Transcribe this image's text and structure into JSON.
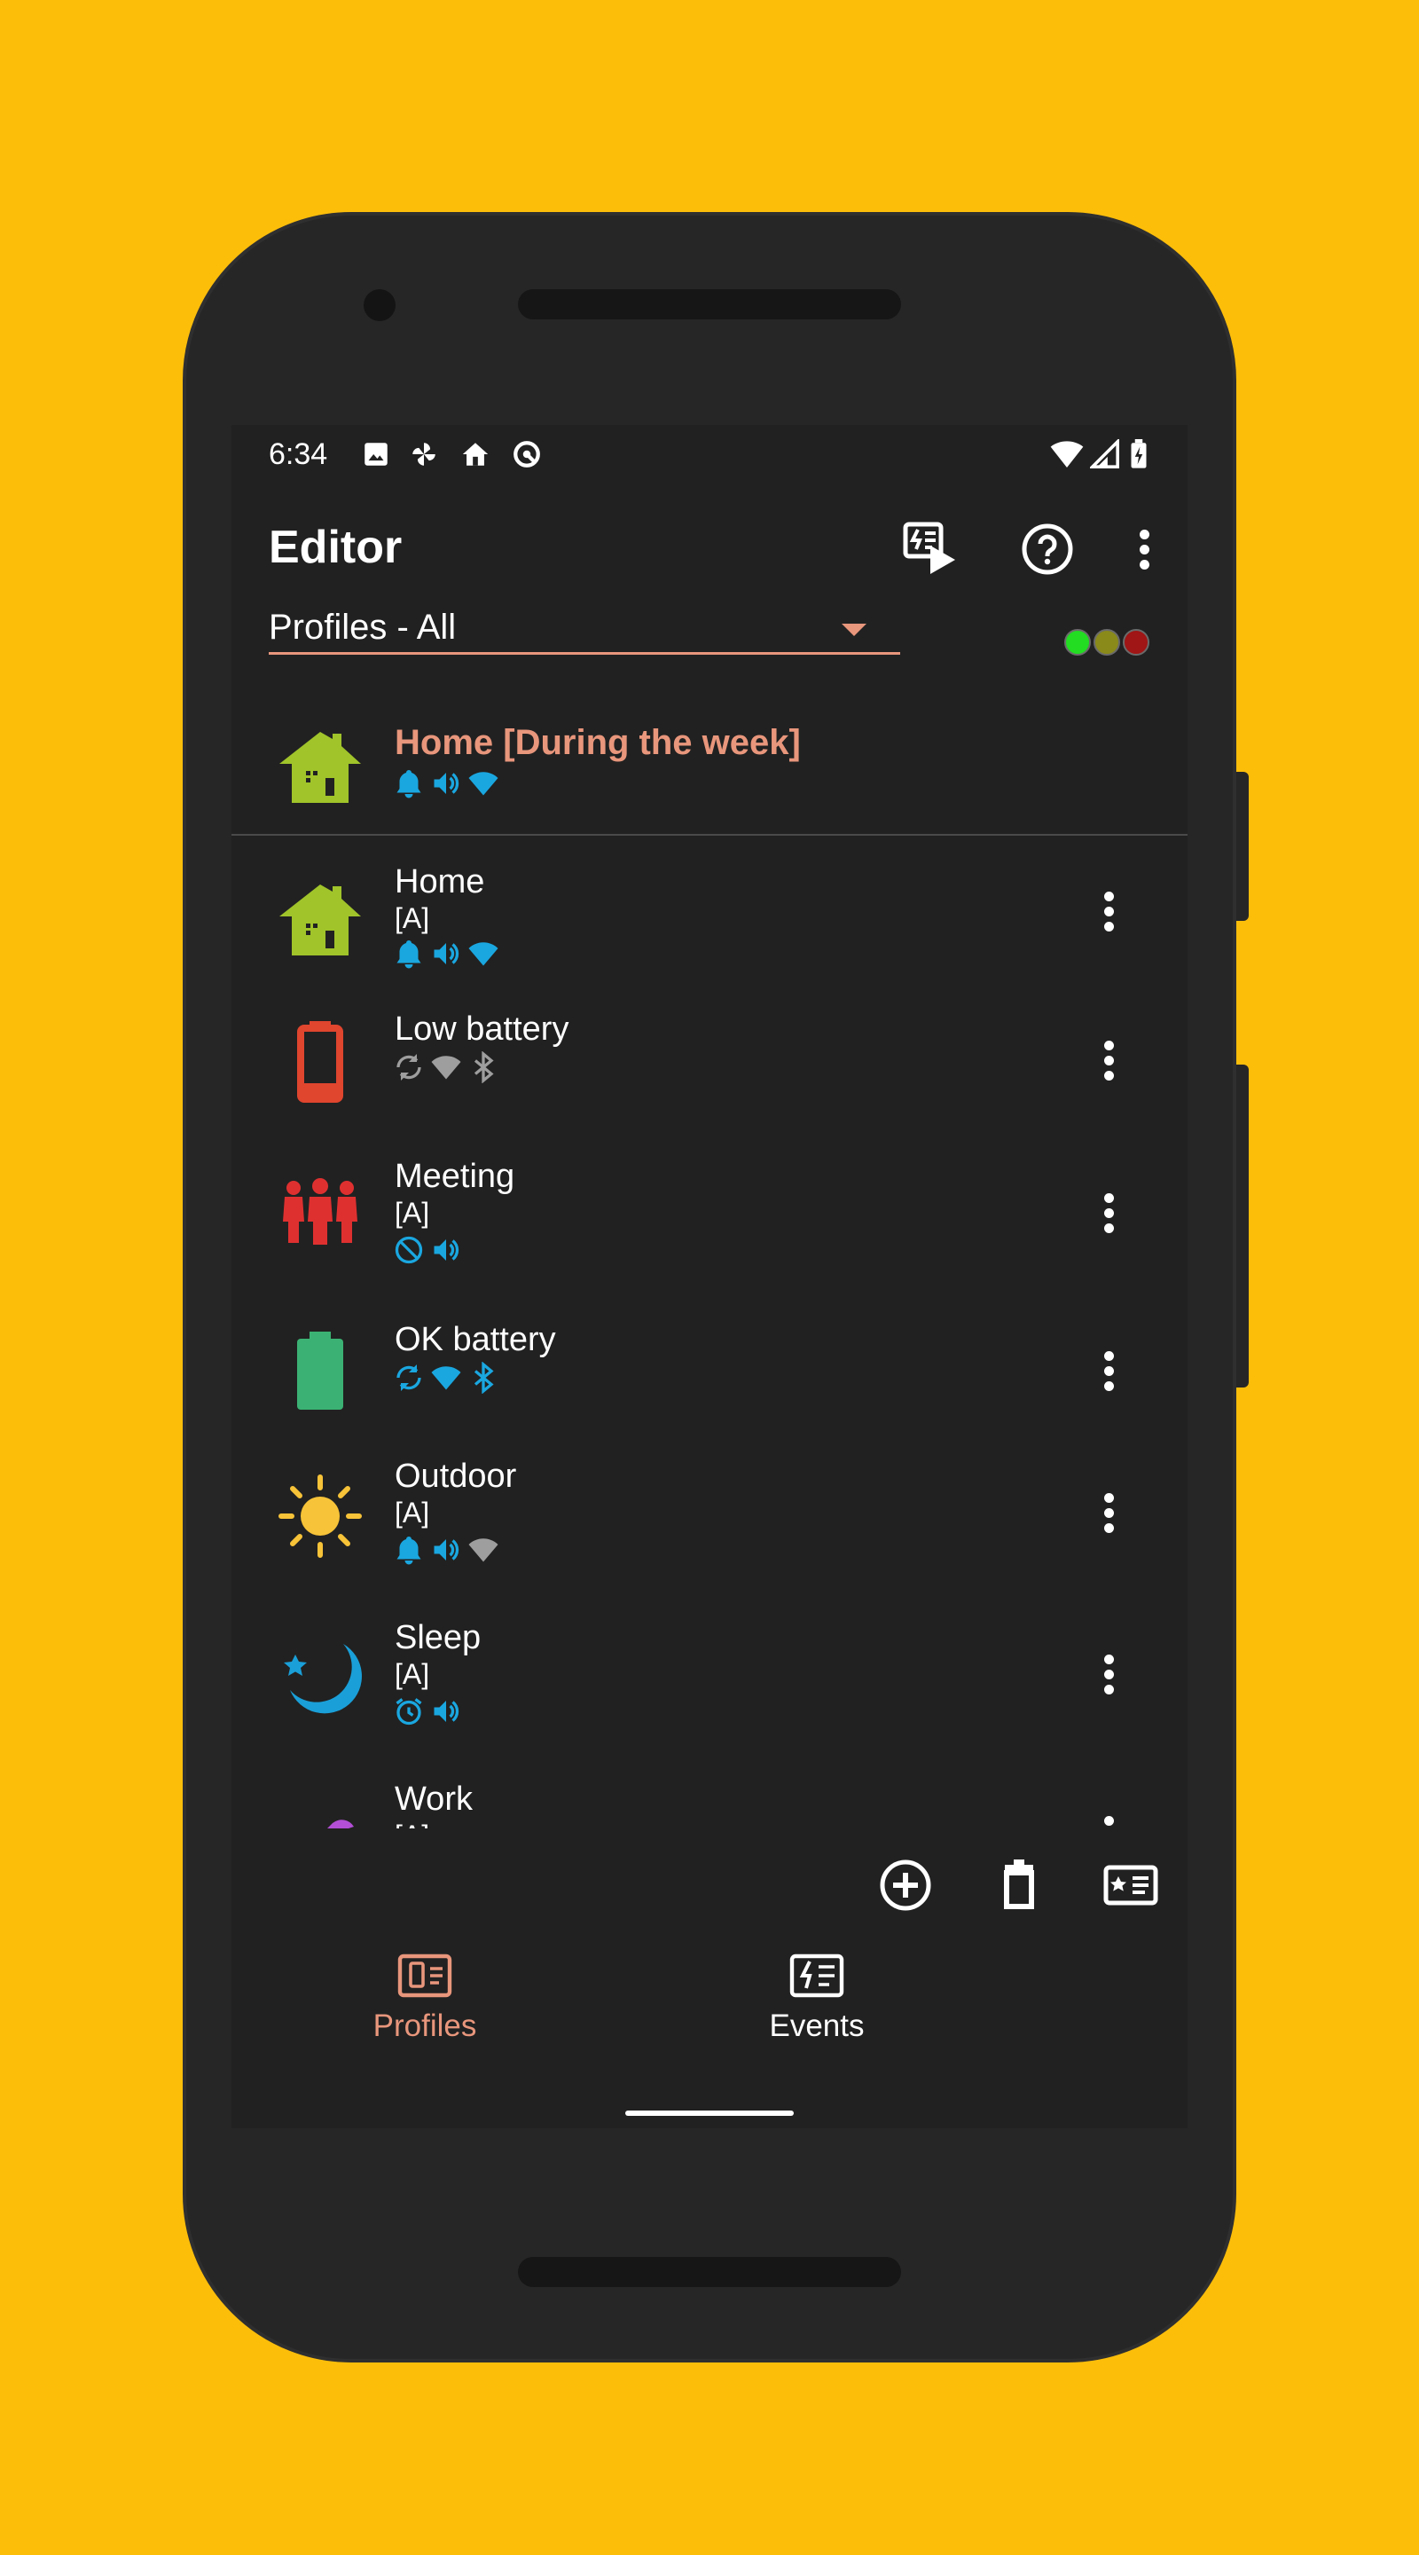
{
  "status_bar": {
    "time": "6:34"
  },
  "toolbar": {
    "title": "Editor"
  },
  "filter": {
    "selected": "Profiles - All"
  },
  "colors": {
    "accent": "#E8967C",
    "icon_blue": "#1AA7E0",
    "icon_gray": "#9E9E9E",
    "background": "#FDBE0A"
  },
  "traffic_lights": [
    "#22DD22",
    "#8A8A1A",
    "#A01515"
  ],
  "active_profile": {
    "name": "Home [During the week]",
    "icon": "house-icon"
  },
  "profiles": [
    {
      "name": "Home",
      "sub": "[A]",
      "icon": "house-icon"
    },
    {
      "name": "Low battery",
      "sub": "",
      "icon": "battery-low-icon"
    },
    {
      "name": "Meeting",
      "sub": "[A]",
      "icon": "people-icon"
    },
    {
      "name": "OK battery",
      "sub": "",
      "icon": "battery-full-icon"
    },
    {
      "name": "Outdoor",
      "sub": "[A]",
      "icon": "sun-icon"
    },
    {
      "name": "Sleep",
      "sub": "[A]",
      "icon": "moon-icon"
    },
    {
      "name": "Work",
      "sub": "[A]",
      "icon": "work-icon"
    }
  ],
  "bottom_nav": {
    "profiles_label": "Profiles",
    "events_label": "Events"
  }
}
